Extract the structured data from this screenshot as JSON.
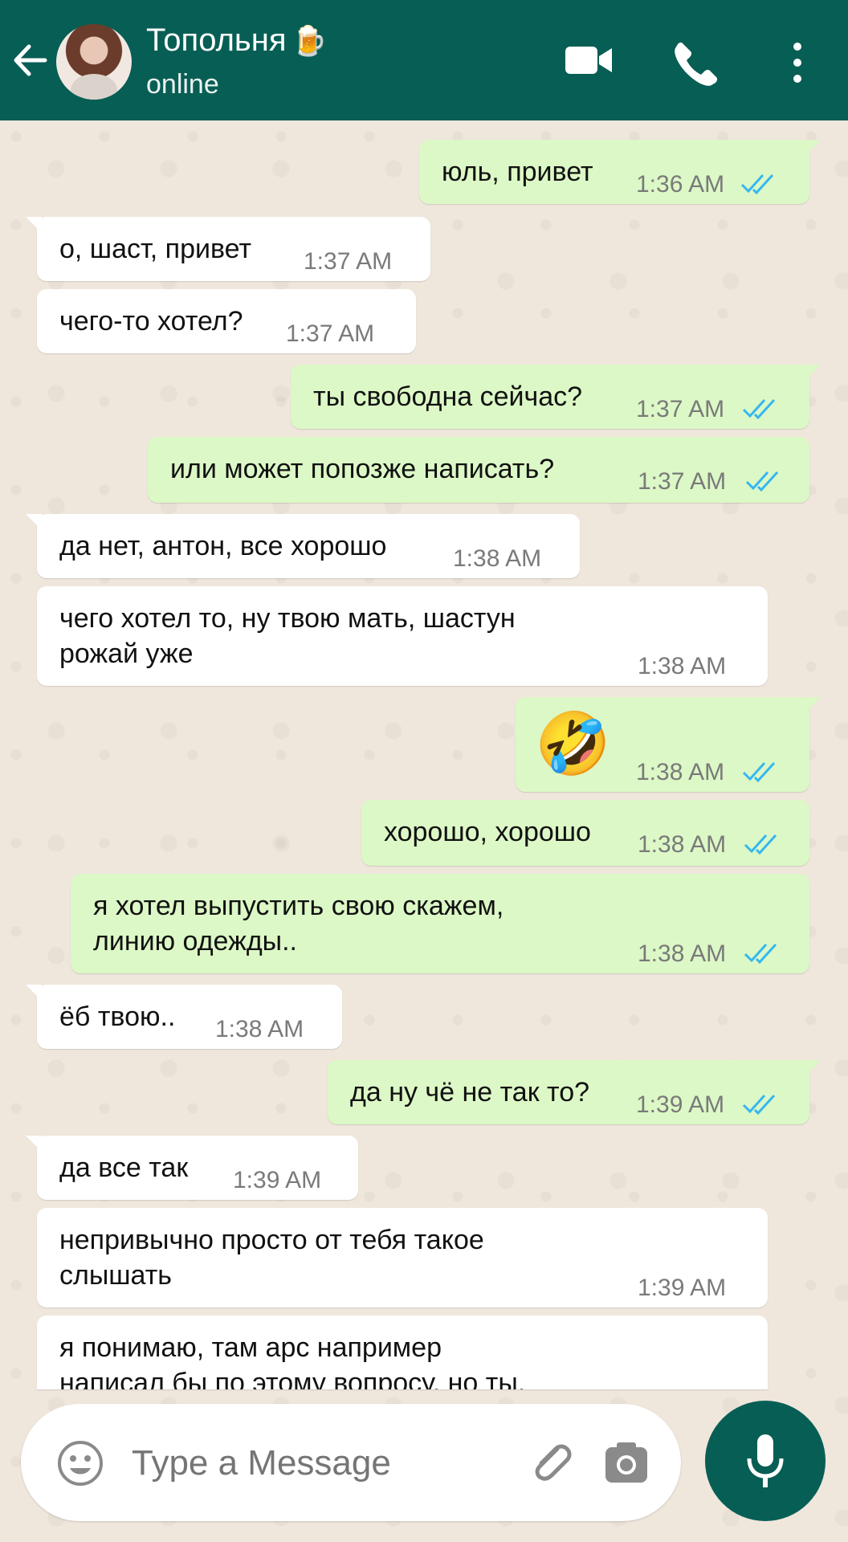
{
  "header": {
    "contact_name": "Топольня",
    "beer_emoji": "🍺",
    "status": "online",
    "icons": [
      "back-arrow-icon",
      "video-call-icon",
      "phone-call-icon",
      "more-menu-icon"
    ],
    "accent_color": "#075e54"
  },
  "messages": [
    {
      "dir": "out",
      "text": "юль, привет",
      "time": "1:36 AM"
    },
    {
      "dir": "in",
      "text": "о, шаст, привет",
      "time": "1:37 AM"
    },
    {
      "dir": "in",
      "text": "чего-то хотел?",
      "time": "1:37 AM"
    },
    {
      "dir": "out",
      "text": "ты свободна сейчас?",
      "time": "1:37 AM"
    },
    {
      "dir": "out",
      "text": "или может попозже написать?",
      "time": "1:37 AM"
    },
    {
      "dir": "in",
      "text": "да нет, антон, все хорошо",
      "time": "1:38 AM"
    },
    {
      "dir": "in",
      "text": "чего хотел то, ну твою мать, шастун\nрожай уже",
      "time": "1:38 AM"
    },
    {
      "dir": "out",
      "text": "🤣",
      "time": "1:38 AM"
    },
    {
      "dir": "out",
      "text": "хорошо, хорошо",
      "time": "1:38 AM"
    },
    {
      "dir": "out",
      "text": "я хотел выпустить свою скажем,\nлинию одежды..",
      "time": "1:38 AM"
    },
    {
      "dir": "in",
      "text": "ёб твою..",
      "time": "1:38 AM"
    },
    {
      "dir": "out",
      "text": "да ну чё не так то?",
      "time": "1:39 AM"
    },
    {
      "dir": "in",
      "text": "да все так",
      "time": "1:39 AM"
    },
    {
      "dir": "in",
      "text": "непривычно просто от тебя такое\nслышать",
      "time": "1:39 AM"
    },
    {
      "dir": "in",
      "text": "я понимаю, там арс например\nнаписал бы по этому вопросу, но ты,",
      "time": ""
    }
  ],
  "composer": {
    "placeholder": "Type a Message",
    "icons": [
      "emoji-icon",
      "attach-icon",
      "camera-icon",
      "mic-icon"
    ]
  },
  "colors": {
    "outgoing_bubble": "#dcf8c6",
    "incoming_bubble": "#ffffff",
    "read_ticks": "#34b7f1"
  }
}
